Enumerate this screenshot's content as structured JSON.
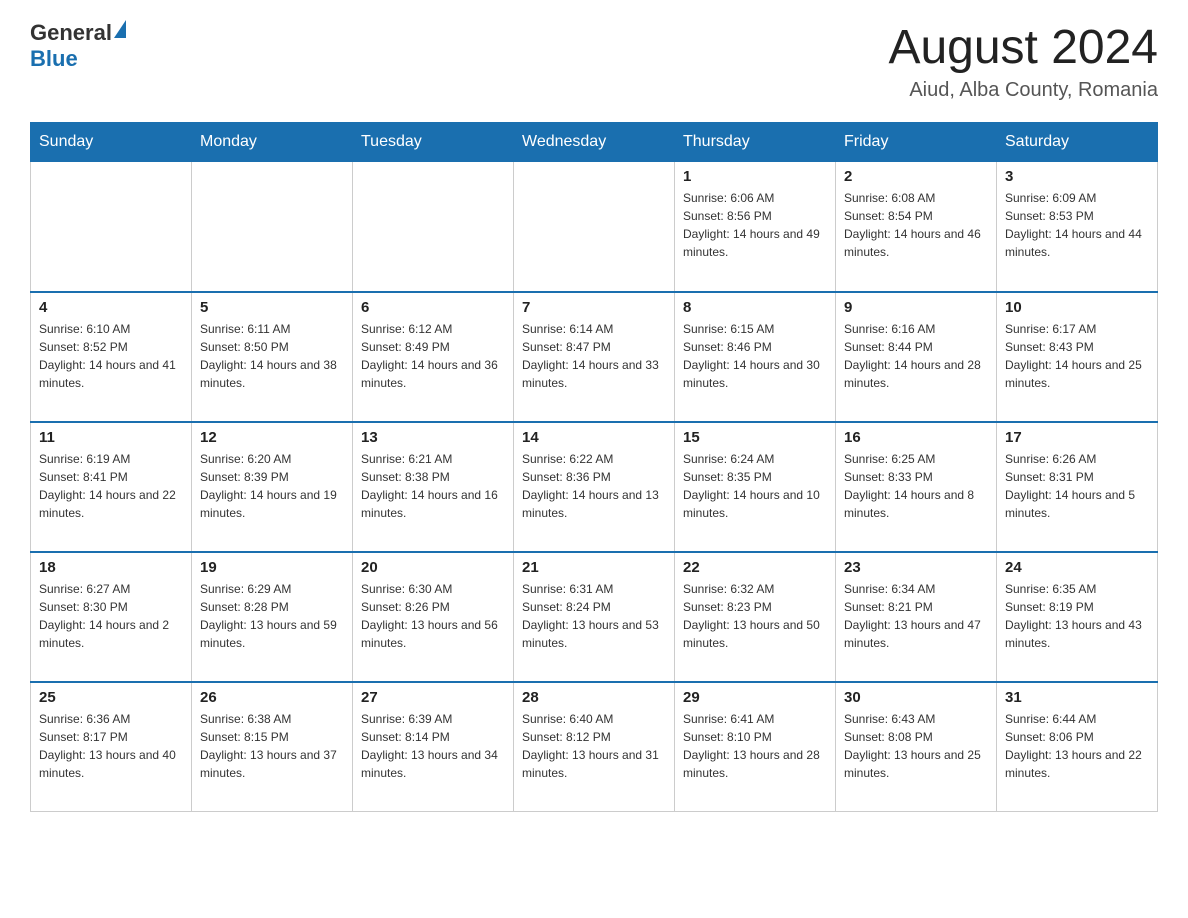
{
  "header": {
    "logo_general": "General",
    "logo_blue": "Blue",
    "title": "August 2024",
    "location": "Aiud, Alba County, Romania"
  },
  "days_of_week": [
    "Sunday",
    "Monday",
    "Tuesday",
    "Wednesday",
    "Thursday",
    "Friday",
    "Saturday"
  ],
  "weeks": [
    [
      {
        "day": "",
        "info": ""
      },
      {
        "day": "",
        "info": ""
      },
      {
        "day": "",
        "info": ""
      },
      {
        "day": "",
        "info": ""
      },
      {
        "day": "1",
        "info": "Sunrise: 6:06 AM\nSunset: 8:56 PM\nDaylight: 14 hours and 49 minutes."
      },
      {
        "day": "2",
        "info": "Sunrise: 6:08 AM\nSunset: 8:54 PM\nDaylight: 14 hours and 46 minutes."
      },
      {
        "day": "3",
        "info": "Sunrise: 6:09 AM\nSunset: 8:53 PM\nDaylight: 14 hours and 44 minutes."
      }
    ],
    [
      {
        "day": "4",
        "info": "Sunrise: 6:10 AM\nSunset: 8:52 PM\nDaylight: 14 hours and 41 minutes."
      },
      {
        "day": "5",
        "info": "Sunrise: 6:11 AM\nSunset: 8:50 PM\nDaylight: 14 hours and 38 minutes."
      },
      {
        "day": "6",
        "info": "Sunrise: 6:12 AM\nSunset: 8:49 PM\nDaylight: 14 hours and 36 minutes."
      },
      {
        "day": "7",
        "info": "Sunrise: 6:14 AM\nSunset: 8:47 PM\nDaylight: 14 hours and 33 minutes."
      },
      {
        "day": "8",
        "info": "Sunrise: 6:15 AM\nSunset: 8:46 PM\nDaylight: 14 hours and 30 minutes."
      },
      {
        "day": "9",
        "info": "Sunrise: 6:16 AM\nSunset: 8:44 PM\nDaylight: 14 hours and 28 minutes."
      },
      {
        "day": "10",
        "info": "Sunrise: 6:17 AM\nSunset: 8:43 PM\nDaylight: 14 hours and 25 minutes."
      }
    ],
    [
      {
        "day": "11",
        "info": "Sunrise: 6:19 AM\nSunset: 8:41 PM\nDaylight: 14 hours and 22 minutes."
      },
      {
        "day": "12",
        "info": "Sunrise: 6:20 AM\nSunset: 8:39 PM\nDaylight: 14 hours and 19 minutes."
      },
      {
        "day": "13",
        "info": "Sunrise: 6:21 AM\nSunset: 8:38 PM\nDaylight: 14 hours and 16 minutes."
      },
      {
        "day": "14",
        "info": "Sunrise: 6:22 AM\nSunset: 8:36 PM\nDaylight: 14 hours and 13 minutes."
      },
      {
        "day": "15",
        "info": "Sunrise: 6:24 AM\nSunset: 8:35 PM\nDaylight: 14 hours and 10 minutes."
      },
      {
        "day": "16",
        "info": "Sunrise: 6:25 AM\nSunset: 8:33 PM\nDaylight: 14 hours and 8 minutes."
      },
      {
        "day": "17",
        "info": "Sunrise: 6:26 AM\nSunset: 8:31 PM\nDaylight: 14 hours and 5 minutes."
      }
    ],
    [
      {
        "day": "18",
        "info": "Sunrise: 6:27 AM\nSunset: 8:30 PM\nDaylight: 14 hours and 2 minutes."
      },
      {
        "day": "19",
        "info": "Sunrise: 6:29 AM\nSunset: 8:28 PM\nDaylight: 13 hours and 59 minutes."
      },
      {
        "day": "20",
        "info": "Sunrise: 6:30 AM\nSunset: 8:26 PM\nDaylight: 13 hours and 56 minutes."
      },
      {
        "day": "21",
        "info": "Sunrise: 6:31 AM\nSunset: 8:24 PM\nDaylight: 13 hours and 53 minutes."
      },
      {
        "day": "22",
        "info": "Sunrise: 6:32 AM\nSunset: 8:23 PM\nDaylight: 13 hours and 50 minutes."
      },
      {
        "day": "23",
        "info": "Sunrise: 6:34 AM\nSunset: 8:21 PM\nDaylight: 13 hours and 47 minutes."
      },
      {
        "day": "24",
        "info": "Sunrise: 6:35 AM\nSunset: 8:19 PM\nDaylight: 13 hours and 43 minutes."
      }
    ],
    [
      {
        "day": "25",
        "info": "Sunrise: 6:36 AM\nSunset: 8:17 PM\nDaylight: 13 hours and 40 minutes."
      },
      {
        "day": "26",
        "info": "Sunrise: 6:38 AM\nSunset: 8:15 PM\nDaylight: 13 hours and 37 minutes."
      },
      {
        "day": "27",
        "info": "Sunrise: 6:39 AM\nSunset: 8:14 PM\nDaylight: 13 hours and 34 minutes."
      },
      {
        "day": "28",
        "info": "Sunrise: 6:40 AM\nSunset: 8:12 PM\nDaylight: 13 hours and 31 minutes."
      },
      {
        "day": "29",
        "info": "Sunrise: 6:41 AM\nSunset: 8:10 PM\nDaylight: 13 hours and 28 minutes."
      },
      {
        "day": "30",
        "info": "Sunrise: 6:43 AM\nSunset: 8:08 PM\nDaylight: 13 hours and 25 minutes."
      },
      {
        "day": "31",
        "info": "Sunrise: 6:44 AM\nSunset: 8:06 PM\nDaylight: 13 hours and 22 minutes."
      }
    ]
  ]
}
